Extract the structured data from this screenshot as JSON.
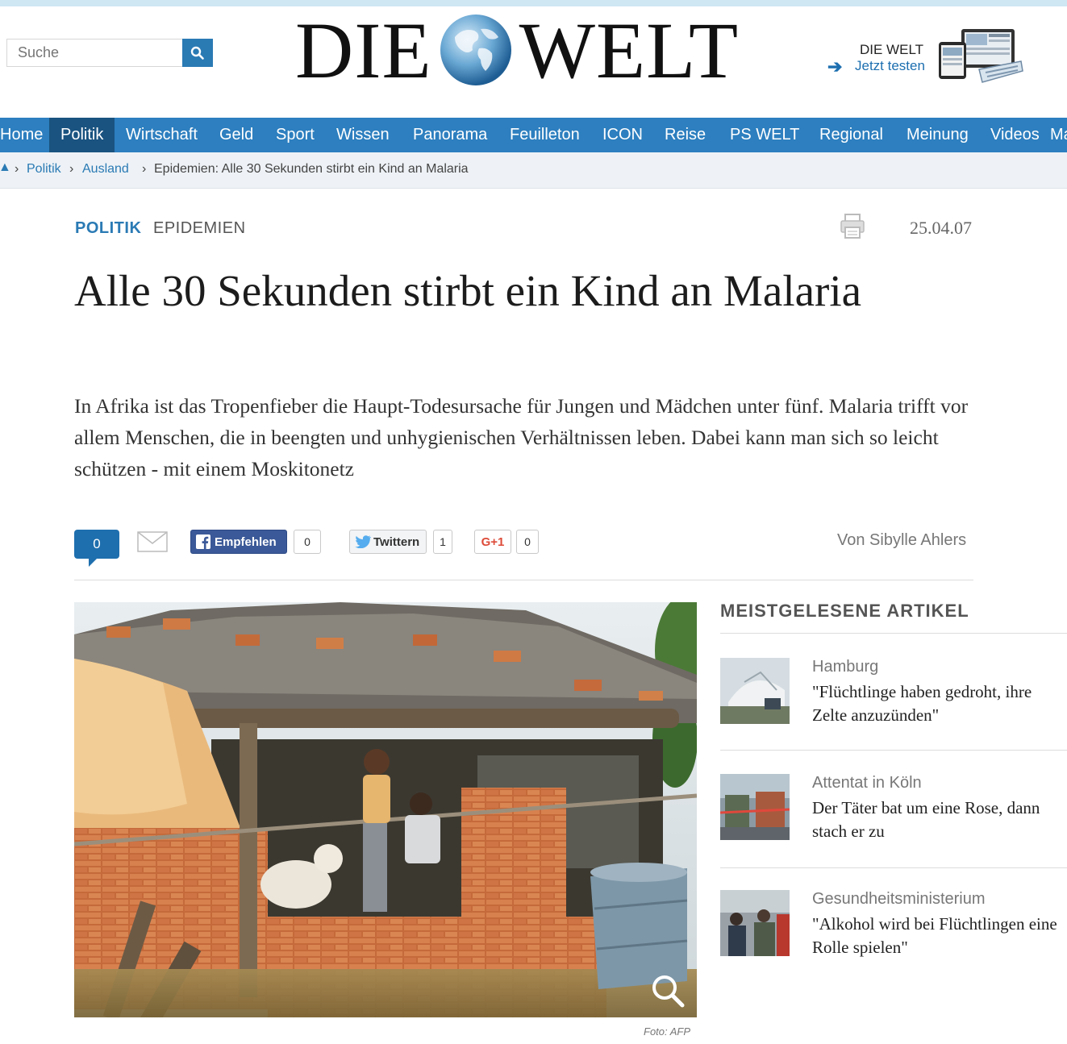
{
  "search": {
    "placeholder": "Suche"
  },
  "logo": {
    "left": "DIE",
    "right": "WELT"
  },
  "promo": {
    "line1": "DIE WELT",
    "line2": "Jetzt testen"
  },
  "nav": [
    "Home",
    "Politik",
    "Wirtschaft",
    "Geld",
    "Sport",
    "Wissen",
    "Panorama",
    "Feuilleton",
    "ICON",
    "Reise",
    "PS WELT",
    "Regional",
    "Meinung",
    "Videos",
    "Ma"
  ],
  "nav_active": "Politik",
  "breadcrumb": {
    "items": [
      "Politik",
      "Ausland",
      "Epidemien: Alle 30 Sekunden stirbt ein Kind an Malaria"
    ]
  },
  "article": {
    "category": "POLITIK",
    "topic": "EPIDEMIEN",
    "date": "25.04.07",
    "headline": "Alle 30 Sekunden stirbt ein Kind an Malaria",
    "lead": "In Afrika ist das Tropenfieber die Haupt-Todesursache für Jungen und Mädchen unter fünf. Malaria trifft vor allem Menschen, die in beengten und unhygienischen Verhältnissen leben. Dabei kann man sich so leicht schützen - mit einem Moskitonetz",
    "comment_count": "0",
    "byline": "Von Sibylle Ahlers",
    "photo_credit": "Foto: AFP"
  },
  "share": {
    "facebook_label": "Empfehlen",
    "facebook_count": "0",
    "twitter_label": "Twittern",
    "twitter_count": "1",
    "gplus_label": "G+1",
    "gplus_count": "0"
  },
  "sidebar": {
    "title": "MEISTGELESENE ARTIKEL",
    "items": [
      {
        "kicker": "Hamburg",
        "title": "\"Flüchtlinge haben gedroht, ihre Zelte anzuzünden\""
      },
      {
        "kicker": "Attentat in Köln",
        "title": "Der Täter bat um eine Rose, dann stach er zu"
      },
      {
        "kicker": "Gesundheitsministerium",
        "title": "\"Alkohol wird bei Flüchtlingen eine Rolle spielen\""
      }
    ]
  },
  "colors": {
    "brand_blue": "#2d7fbf",
    "nav_active": "#1a5380",
    "link": "#2a7ab4"
  }
}
